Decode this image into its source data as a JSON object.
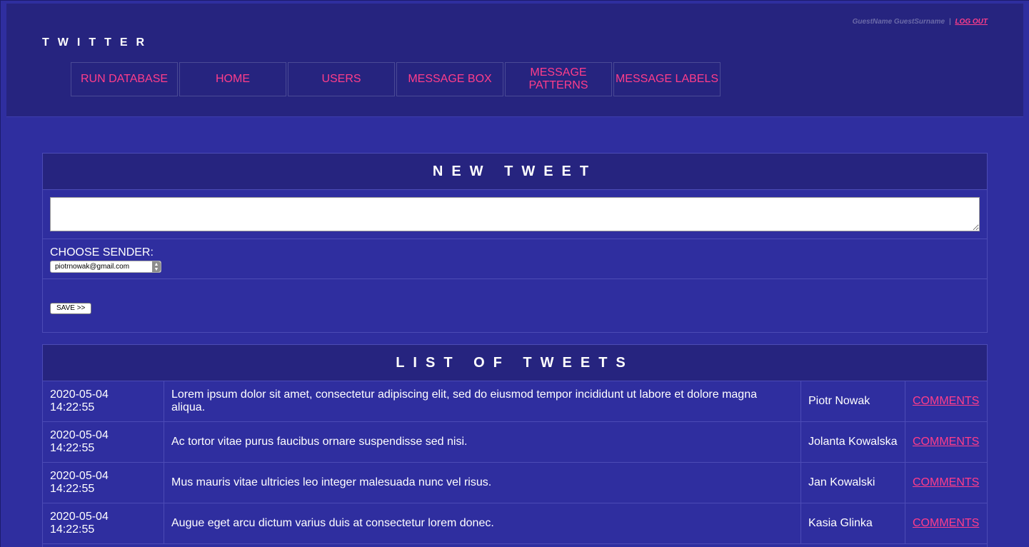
{
  "header": {
    "brand": "TWITTER",
    "user_name": "GuestName GuestSurname",
    "separator": "|",
    "logout_label": "LOG OUT"
  },
  "nav": {
    "items": [
      {
        "label": "RUN DATABASE"
      },
      {
        "label": "HOME"
      },
      {
        "label": "USERS"
      },
      {
        "label": "MESSAGE BOX"
      },
      {
        "label": "MESSAGE PATTERNS"
      },
      {
        "label": "MESSAGE LABELS"
      }
    ]
  },
  "new_tweet": {
    "title": "NEW TWEET",
    "textarea_value": "",
    "sender_label": "CHOOSE SENDER:",
    "sender_selected": "piotrnowak@gmail.com",
    "save_label": "SAVE >>"
  },
  "list": {
    "title": "LIST OF TWEETS",
    "rows": [
      {
        "date": "2020-05-04",
        "time": "14:22:55",
        "text": "Lorem ipsum dolor sit amet, consectetur adipiscing elit, sed do eiusmod tempor incididunt ut labore et dolore magna aliqua.",
        "author": "Piotr Nowak",
        "link": "COMMENTS"
      },
      {
        "date": "2020-05-04",
        "time": "14:22:55",
        "text": "Ac tortor vitae purus faucibus ornare suspendisse sed nisi.",
        "author": "Jolanta Kowalska",
        "link": "COMMENTS"
      },
      {
        "date": "2020-05-04",
        "time": "14:22:55",
        "text": "Mus mauris vitae ultricies leo integer malesuada nunc vel risus.",
        "author": "Jan Kowalski",
        "link": "COMMENTS"
      },
      {
        "date": "2020-05-04",
        "time": "14:22:55",
        "text": "Augue eget arcu dictum varius duis at consectetur lorem donec.",
        "author": "Kasia Glinka",
        "link": "COMMENTS"
      }
    ]
  },
  "colors": {
    "page_bg": "#2f2e9f",
    "header_bg": "#26247f",
    "accent": "#ff3d8a",
    "text": "#ffffff"
  }
}
